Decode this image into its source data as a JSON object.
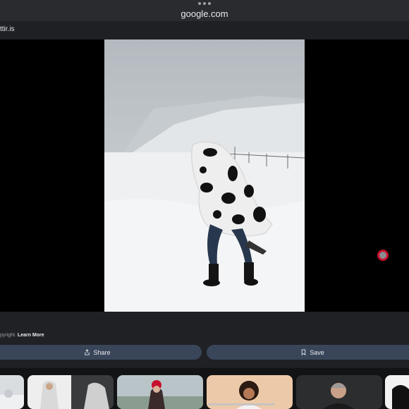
{
  "browser": {
    "url": "google.com",
    "site_label": "ttir.is"
  },
  "viewer": {
    "image_alt": "Person wrapped in a white blanket with black hand prints walking in snowy landscape"
  },
  "info": {
    "copyright_prefix": "pyright.",
    "learn_more": "Learn More",
    "share_label": "Share",
    "save_label": "Save"
  },
  "related": {
    "thumbnails": [
      "snowy-scene",
      "white-hooded-coat",
      "red-beanie-person",
      "curly-hair-woman",
      "grey-hair-man",
      "partial-thumb"
    ]
  },
  "colors": {
    "button_bg": "#39465a",
    "indicator_ring": "#c8102e"
  }
}
